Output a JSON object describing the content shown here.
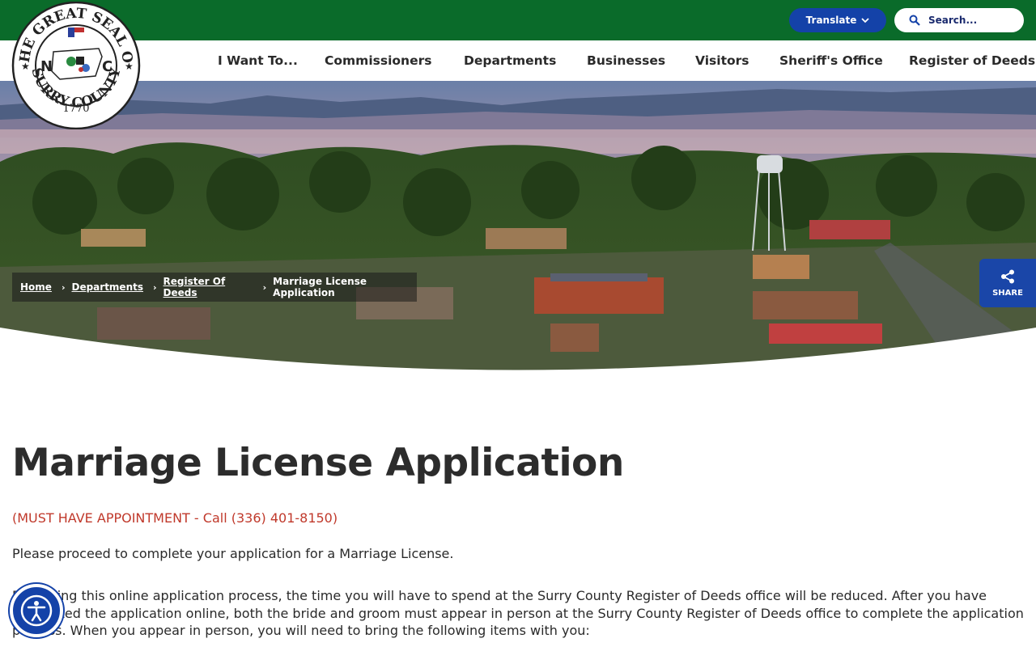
{
  "header": {
    "translate_label": "Translate",
    "search_placeholder": "Search...",
    "seal": {
      "top_text": "THE GREAT SEAL OF",
      "bottom_text": "SURRY COUNTY",
      "year": "1770",
      "letters": [
        "N",
        "C"
      ]
    }
  },
  "nav": {
    "items": [
      {
        "label": "I Want To..."
      },
      {
        "label": "Commissioners"
      },
      {
        "label": "Departments"
      },
      {
        "label": "Businesses"
      },
      {
        "label": "Visitors"
      },
      {
        "label": "Sheriff's Office"
      },
      {
        "label": "Register of Deeds"
      }
    ]
  },
  "breadcrumb": {
    "items": [
      {
        "label": "Home"
      },
      {
        "label": "Departments"
      },
      {
        "label": "Register Of Deeds"
      }
    ],
    "current": "Marriage License Application"
  },
  "share": {
    "label": "SHARE"
  },
  "content": {
    "title": "Marriage License Application",
    "appointment": "(MUST HAVE APPOINTMENT - Call (336) 401-8150)",
    "intro": "Please proceed to complete your application for a Marriage License.",
    "paragraph": "Beginning this online application process, the time you will have to spend at the Surry County Register of Deeds office will be reduced. After you have completed the application online, both the bride and groom must appear in person at the Surry County Register of Deeds office to complete the application process. When you appear in person, you will need to bring the following items with you:"
  },
  "colors": {
    "topbar_green": "#0a6b2a",
    "brand_blue": "#1442a8",
    "appointment_red": "#c0392b"
  },
  "icons": {
    "translate": "chevron-down-icon",
    "search": "search-icon",
    "share": "share-icon",
    "accessibility": "accessibility-icon"
  }
}
